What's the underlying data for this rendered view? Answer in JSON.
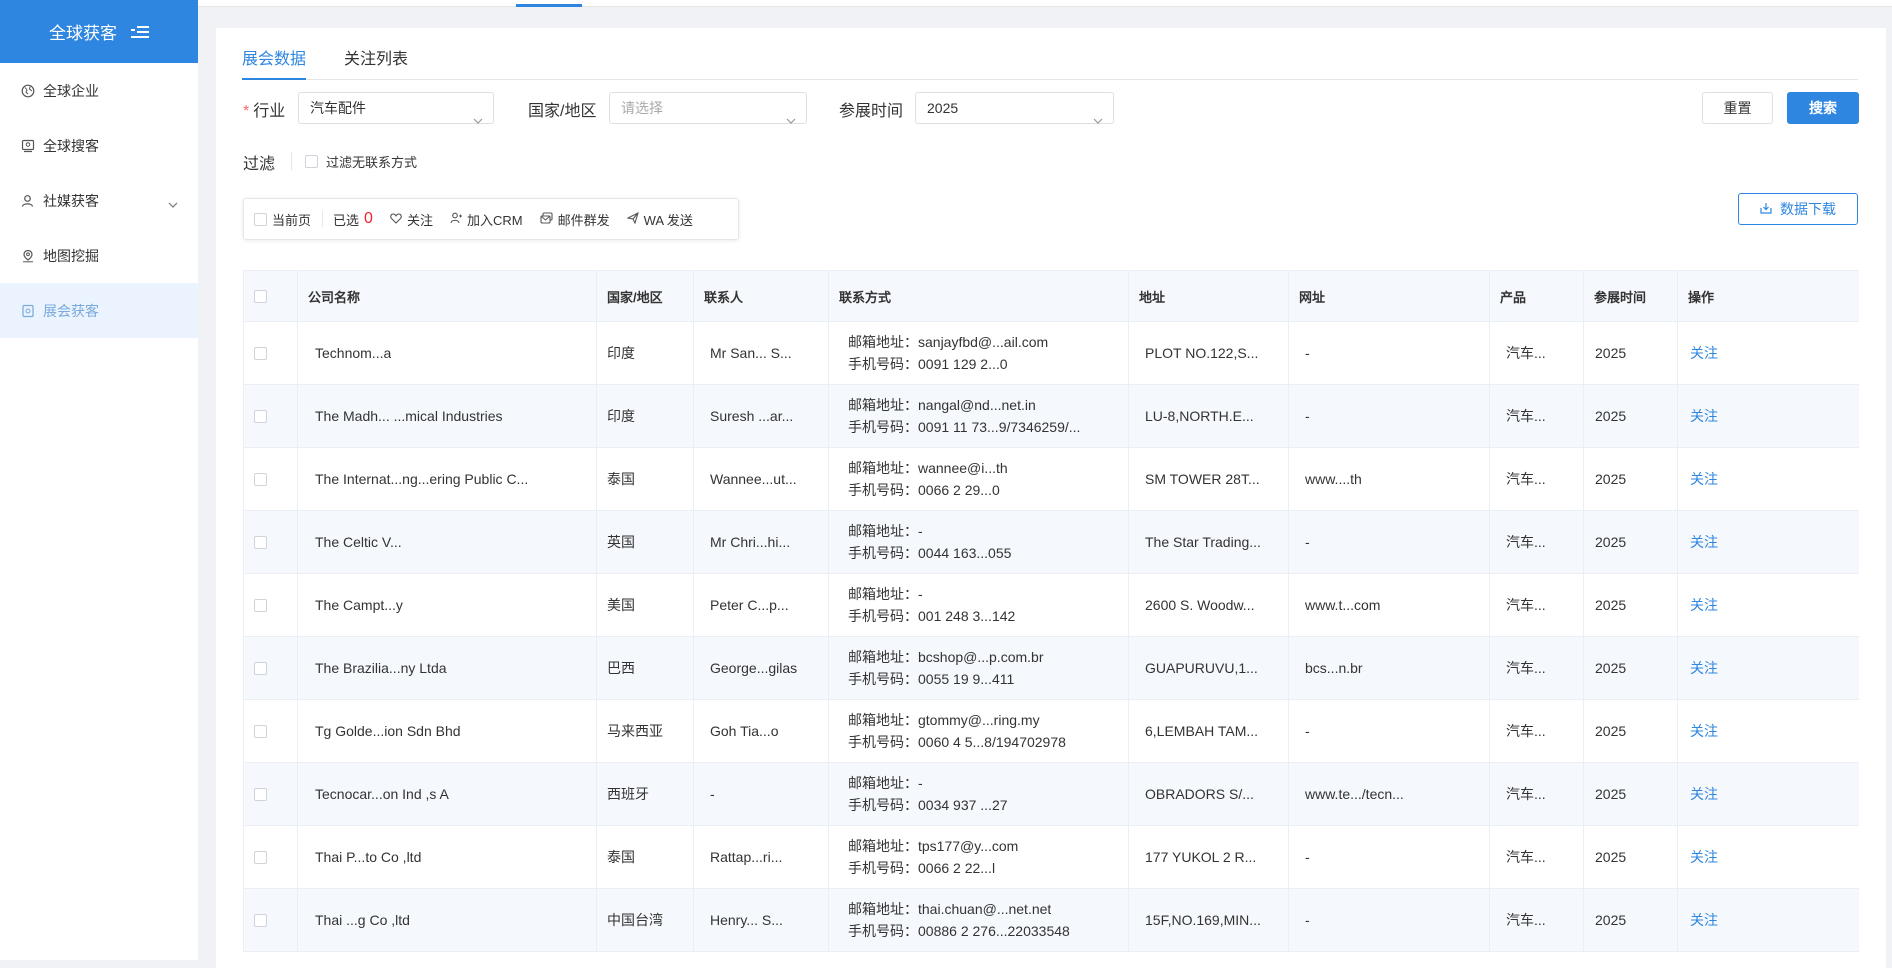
{
  "sidebar": {
    "brand_label": "全球获客",
    "items": [
      {
        "label": "全球企业"
      },
      {
        "label": "全球搜客"
      },
      {
        "label": "社媒获客"
      },
      {
        "label": "地图挖掘"
      },
      {
        "label": "展会获客"
      }
    ]
  },
  "tabs": [
    {
      "label": "展会数据"
    },
    {
      "label": "关注列表"
    }
  ],
  "filters": {
    "industry_label": "行业",
    "industry_value": "汽车配件",
    "country_label": "国家/地区",
    "country_placeholder": "请选择",
    "time_label": "参展时间",
    "time_value": "2025",
    "reset_label": "重置",
    "search_label": "搜索",
    "filter_label": "过滤",
    "filter_no_contact_label": "过滤无联系方式"
  },
  "toolbar": {
    "current_page_label": "当前页",
    "selected_label": "已选",
    "selected_count": "0",
    "follow_label": "关注",
    "crm_label": "加入CRM",
    "mass_email_label": "邮件群发",
    "wa_label": "WA 发送",
    "download_label": "数据下载"
  },
  "table": {
    "headers": [
      "公司名称",
      "国家/地区",
      "联系人",
      "联系方式",
      "地址",
      "网址",
      "产品",
      "参展时间",
      "操作"
    ],
    "email_prefix": "邮箱地址：",
    "phone_prefix": "手机号码：",
    "rows": [
      {
        "company": "Technom...a",
        "country": "印度",
        "contact": "Mr San... S...",
        "email": "sanjayfbd@...ail.com",
        "phone": "0091 129 2...0",
        "address": "PLOT NO.122,S...",
        "website": "-",
        "product": "汽车...",
        "year": "2025",
        "action": "关注"
      },
      {
        "company": "The Madh... ...mical Industries",
        "country": "印度",
        "contact": "Suresh ...ar...",
        "email": "nangal@nd...net.in",
        "phone": "0091 11 73...9/7346259/...",
        "address": "LU-8,NORTH.E...",
        "website": "-",
        "product": "汽车...",
        "year": "2025",
        "action": "关注"
      },
      {
        "company": "The Internat...ng...ering Public C...",
        "country": "泰国",
        "contact": "Wannee...ut...",
        "email": "wannee@i...th",
        "phone": "0066 2 29...0",
        "address": "SM TOWER 28T...",
        "website": "www....th",
        "product": "汽车...",
        "year": "2025",
        "action": "关注"
      },
      {
        "company": "The Celtic V...",
        "country": "英国",
        "contact": "Mr Chri...hi...",
        "email": "-",
        "phone": "0044 163...055",
        "address": "The Star Trading...",
        "website": "-",
        "product": "汽车...",
        "year": "2025",
        "action": "关注"
      },
      {
        "company": "The Campt...y",
        "country": "美国",
        "contact": "Peter C...p...",
        "email": "-",
        "phone": "001 248 3...142",
        "address": "2600 S. Woodw...",
        "website": "www.t...com",
        "product": "汽车...",
        "year": "2025",
        "action": "关注"
      },
      {
        "company": "The Brazilia...ny Ltda",
        "country": "巴西",
        "contact": "George...gilas",
        "email": "bcshop@...p.com.br",
        "phone": "0055 19 9...411",
        "address": "GUAPURUVU,1...",
        "website": "bcs...n.br",
        "product": "汽车...",
        "year": "2025",
        "action": "关注"
      },
      {
        "company": "Tg Golde...ion Sdn Bhd",
        "country": "马来西亚",
        "contact": "Goh Tia...o",
        "email": "gtommy@...ring.my",
        "phone": "0060 4 5...8/194702978",
        "address": "6,LEMBAH TAM...",
        "website": "-",
        "product": "汽车...",
        "year": "2025",
        "action": "关注"
      },
      {
        "company": "Tecnocar...on Ind ,s A",
        "country": "西班牙",
        "contact": "-",
        "email": "-",
        "phone": "0034 937 ...27",
        "address": "OBRADORS S/...",
        "website": "www.te.../tecn...",
        "product": "汽车...",
        "year": "2025",
        "action": "关注"
      },
      {
        "company": "Thai P...to Co ,ltd",
        "country": "泰国",
        "contact": "Rattap...ri...",
        "email": "tps177@y...com",
        "phone": "0066 2 22...l",
        "address": "177 YUKOL 2 R...",
        "website": "-",
        "product": "汽车...",
        "year": "2025",
        "action": "关注"
      },
      {
        "company": "Thai ...g Co ,ltd",
        "country": "中国台湾",
        "contact": "Henry... S...",
        "email": "thai.chuan@...net.net",
        "phone": "00886 2 276...22033548",
        "address": "15F,NO.169,MIN...",
        "website": "-",
        "product": "汽车...",
        "year": "2025",
        "action": "关注"
      }
    ]
  },
  "colors": {
    "accent": "#2f86e0",
    "danger": "#f5222d",
    "active_nav_bg": "#eaf3fe"
  }
}
